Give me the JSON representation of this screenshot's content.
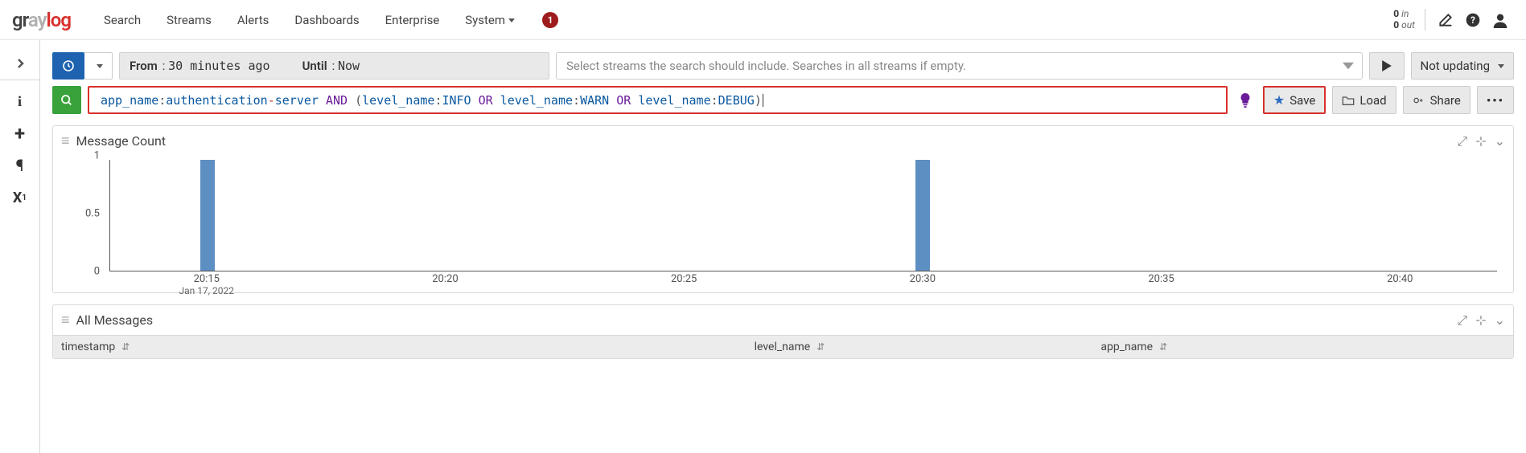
{
  "nav": {
    "items": [
      "Search",
      "Streams",
      "Alerts",
      "Dashboards",
      "Enterprise",
      "System"
    ],
    "notif_count": "1",
    "io_in_n": "0",
    "io_in_l": "in",
    "io_out_n": "0",
    "io_out_l": "out"
  },
  "toolbar": {
    "from_lbl": "From",
    "from_val": "30 minutes ago",
    "until_lbl": "Until",
    "until_val": "Now",
    "streams_placeholder": "Select streams the search should include. Searches in all streams if empty.",
    "updating_lbl": "Not updating"
  },
  "query": {
    "t1": "app_name",
    "c1": ":",
    "v1": "authentication",
    "d1": "-",
    "v1b": "server",
    "op1": "AND",
    "p1": "(",
    "t2": "level_name",
    "c2": ":",
    "v2": "INFO",
    "op2": "OR",
    "t3": "level_name",
    "c3": ":",
    "v3": "WARN",
    "op3": "OR",
    "t4": "level_name",
    "c4": ":",
    "v4": "DEBUG",
    "p2": ")"
  },
  "actions": {
    "save": "Save",
    "load": "Load",
    "share": "Share"
  },
  "panel1": {
    "title": "Message Count"
  },
  "panel2": {
    "title": "All Messages"
  },
  "table": {
    "c1": "timestamp",
    "c2": "level_name",
    "c3": "app_name"
  },
  "chart_data": {
    "type": "bar",
    "title": "Message Count",
    "xlabel": "",
    "ylabel": "",
    "ylim": [
      0,
      1
    ],
    "yticks": [
      0,
      0.5,
      1
    ],
    "categories": [
      "20:15",
      "20:20",
      "20:25",
      "20:30",
      "20:35",
      "20:40"
    ],
    "x_date": "Jan 17, 2022",
    "bars": [
      {
        "x": "20:15",
        "value": 1
      },
      {
        "x": "20:30",
        "value": 1
      }
    ]
  }
}
